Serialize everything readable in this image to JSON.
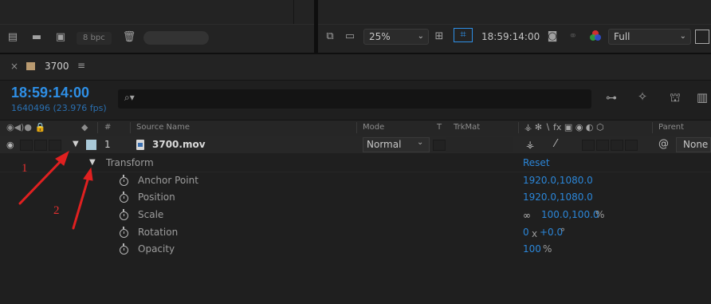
{
  "top_left": {
    "bpc": "8 bpc"
  },
  "viewer": {
    "zoom": "25%",
    "timecode": "18:59:14:00",
    "resolution": "Full"
  },
  "comp_tab": {
    "close": "×",
    "name": "3700",
    "menu": "≡"
  },
  "time": {
    "timecode": "18:59:14:00",
    "frames": "1640496 (23.976 fps)"
  },
  "search": {
    "icon": "⌕▾"
  },
  "headers": {
    "hash": "#",
    "source_name": "Source Name",
    "mode": "Mode",
    "t": "T",
    "trkmat": "TrkMat",
    "switches": "⚶ ✻ ∖ fx ▣ ◉ ◐ ⬡",
    "parent": "Parent"
  },
  "layer": {
    "number": "1",
    "name": "3700.mov",
    "mode": "Normal",
    "parent": "None",
    "label_color": "#a9c9d8"
  },
  "transform": {
    "label": "Transform",
    "reset": "Reset",
    "properties": [
      {
        "label": "Anchor Point",
        "value": "1920.0,1080.0",
        "unit": ""
      },
      {
        "label": "Position",
        "value": "1920.0,1080.0",
        "unit": ""
      },
      {
        "label": "Scale",
        "value": "100.0,100.0",
        "unit": "%"
      },
      {
        "label": "Rotation",
        "value_a": "0",
        "x": "x",
        "value_b": "+0.0",
        "unit": "°"
      },
      {
        "label": "Opacity",
        "value": "100",
        "unit": "%"
      }
    ]
  },
  "annotations": {
    "one": "1",
    "two": "2"
  },
  "colors": {
    "accent": "#2b86d8",
    "arrow": "#e02020",
    "comp_swatch": "#b99a70"
  }
}
